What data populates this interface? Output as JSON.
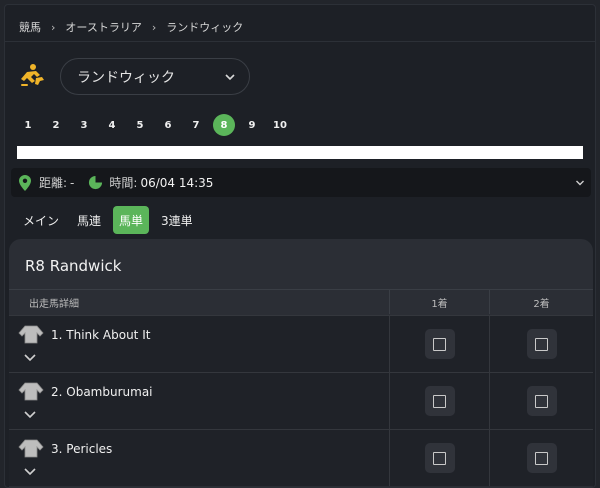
{
  "breadcrumb": [
    "競馬",
    "オーストラリア",
    "ランドウィック"
  ],
  "venue": {
    "selected": "ランドウィック"
  },
  "race_numbers": [
    "1",
    "2",
    "3",
    "4",
    "5",
    "6",
    "7",
    "8",
    "9",
    "10"
  ],
  "active_race": "8",
  "info": {
    "distance_label": "距離:",
    "distance_value": "-",
    "time_label": "時間:",
    "time_value": "06/04 14:35"
  },
  "bet_tabs": [
    "メイン",
    "馬連",
    "馬単",
    "3連単"
  ],
  "active_bet_tab": "馬単",
  "race": {
    "title": "R8 Randwick",
    "columns": {
      "runner": "出走馬詳細",
      "first": "1着",
      "second": "2着"
    },
    "runners": [
      {
        "name": "1. Think About It"
      },
      {
        "name": "2. Obamburumai"
      },
      {
        "name": "3. Pericles"
      }
    ]
  },
  "colors": {
    "accent": "#5bb55a",
    "background": "#1d2026",
    "card": "#2b2e35",
    "icon_yellow": "#f0b429"
  },
  "icons": {
    "sport": "horse-racing-icon",
    "distance": "map-pin-icon",
    "time": "moon-clock-icon"
  }
}
